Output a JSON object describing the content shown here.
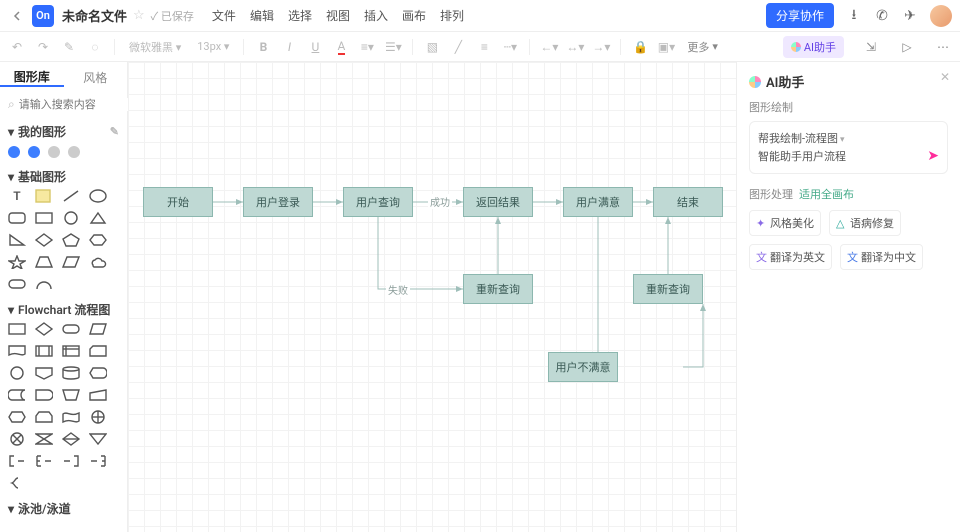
{
  "header": {
    "logo": "On",
    "title": "未命名文件",
    "saved": "已保存",
    "menu": [
      "文件",
      "编辑",
      "选择",
      "视图",
      "插入",
      "画布",
      "排列"
    ],
    "share": "分享协作"
  },
  "toolbar": {
    "font": "微软雅黑",
    "size": "13px",
    "more": "更多",
    "ai_button": "AI助手"
  },
  "sidebar": {
    "tabs": {
      "library": "图形库",
      "style": "风格"
    },
    "search_placeholder": "请输入搜索内容",
    "my_shapes_title": "我的图形",
    "basic_title": "基础图形",
    "flowchart_title": "Flowchart 流程图",
    "swimlane_title": "泳池/泳道"
  },
  "canvas": {
    "nodes": {
      "start": "开始",
      "login": "用户登录",
      "query": "用户查询",
      "result": "返回结果",
      "satisfy": "用户满意",
      "end": "结束",
      "retry1": "重新查询",
      "retry2": "重新查询",
      "unsatisfy": "用户不满意"
    },
    "labels": {
      "success": "成功",
      "fail": "失败"
    }
  },
  "ai": {
    "title": "AI助手",
    "sec1": "图形绘制",
    "card_line1": "帮我绘制-流程图",
    "card_line2": "智能助手用户流程",
    "sec2_a": "图形处理",
    "sec2_b": "适用全画布",
    "chips": {
      "beautify": "风格美化",
      "fix": "语病修复",
      "en": "翻译为英文",
      "zh": "翻译为中文"
    }
  }
}
